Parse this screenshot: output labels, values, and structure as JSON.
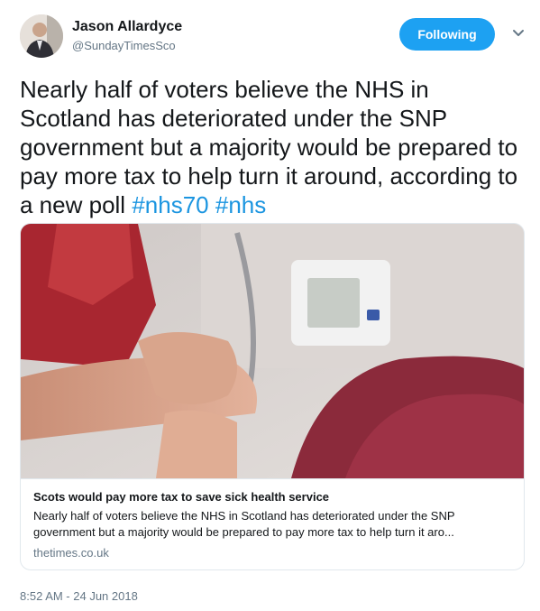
{
  "author": {
    "name": "Jason Allardyce",
    "handle": "@SundayTimesSco"
  },
  "follow_button": {
    "label": "Following",
    "color": "#1da1f2"
  },
  "tweet": {
    "text": "Nearly half of voters believe the NHS in Scotland has deteriorated under the SNP government but a majority would be prepared to pay more tax to help turn it around, according to a new poll ",
    "hashtags": [
      "#nhs70",
      "#nhs"
    ],
    "hashtag_color": "#1b95e0"
  },
  "card": {
    "title": "Scots would pay more tax to save sick health service",
    "description": "Nearly half of voters believe the NHS in Scotland has deteriorated under the SNP government but a majority would be prepared to pay more tax to help turn it aro...",
    "domain": "thetimes.co.uk"
  },
  "timestamp": "8:52 AM - 24 Jun 2018",
  "icons": {
    "menu": "chevron-down-icon"
  }
}
